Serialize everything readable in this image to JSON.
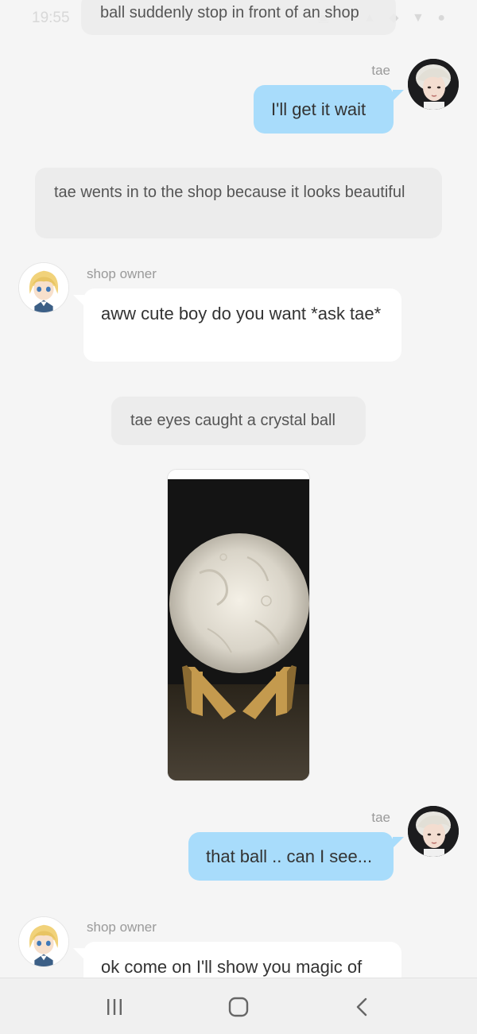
{
  "status_bar": {
    "time": "19:55",
    "icons": "▣ ● ▲ ◆ ▼ ●"
  },
  "messages": {
    "narration_top": "ball suddenly stop in front of an shop",
    "tae_1": {
      "speaker": "tae",
      "text": "I'll get it wait"
    },
    "narration_1": "tae wents in to the shop because it looks beautiful",
    "owner_1": {
      "speaker": "shop owner",
      "text": "aww cute boy do you want *ask tae*"
    },
    "narration_2": "tae eyes caught a crystal ball",
    "tae_2": {
      "speaker": "tae",
      "text": "that ball .. can I see..."
    },
    "owner_2": {
      "speaker": "shop owner",
      "text": "ok come on I'll show you magic of"
    }
  },
  "nav": {
    "recents_icon": "recents-icon",
    "home_icon": "home-icon",
    "back_icon": "back-icon"
  },
  "colors": {
    "background": "#f5f5f5",
    "narration_bg": "#ececec",
    "user_bubble": "#a8dcfb",
    "other_bubble": "#ffffff",
    "speaker_text": "#9a9a9a"
  }
}
